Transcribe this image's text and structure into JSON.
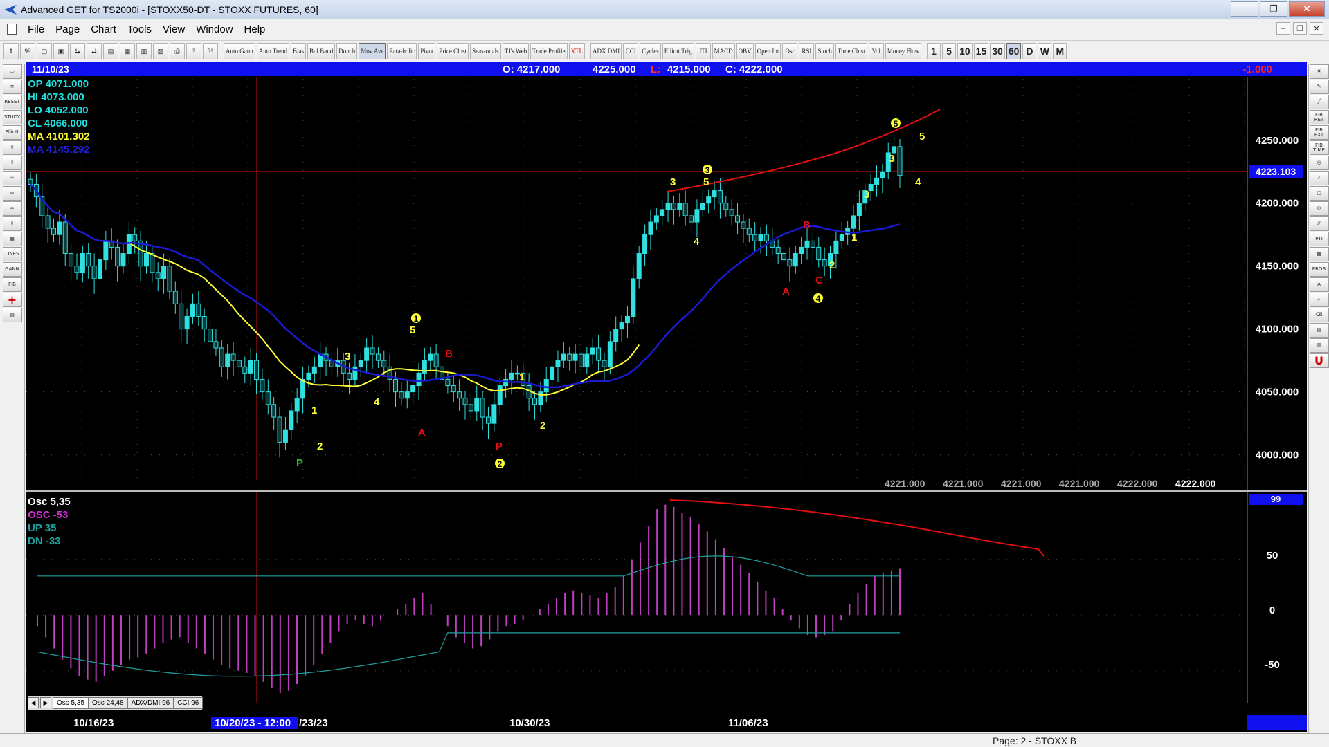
{
  "window": {
    "title": "Advanced GET for TS2000i - [STOXX50-DT - STOXX FUTURES, 60]",
    "minimize": "—",
    "maximize": "❐",
    "close": "✕"
  },
  "menu": {
    "items": [
      "File",
      "Page",
      "Chart",
      "Tools",
      "View",
      "Window",
      "Help"
    ]
  },
  "toolbar": {
    "icons": [
      "⇕",
      "99",
      "▢",
      "▣",
      "⇆",
      "⇄",
      "▤",
      "▦",
      "▥",
      "▨",
      "⎙",
      "?",
      "?!"
    ],
    "studies": [
      "Auto Gann",
      "Auto Trend",
      "Bias",
      "Bol Band",
      "Donch",
      "Mov Ave",
      "Para-bolic",
      "Pivot",
      "Price Clust",
      "Seas-onals",
      "TJ's Web",
      "Trade Profile",
      "XTL",
      "ADX DMI",
      "CCI",
      "Cycles",
      "Elliott Trig",
      "JTI",
      "MACD",
      "OBV",
      "Open Int",
      "Osc",
      "RSI",
      "Stoch",
      "Time Clust",
      "Vol",
      "Money Flow"
    ],
    "timeframes": [
      "1",
      "5",
      "10",
      "15",
      "30",
      "60",
      "D",
      "W",
      "M"
    ],
    "active_timeframe": "60"
  },
  "header": {
    "date": "11/10/23",
    "open": "O: 4217.000",
    "high": "4225.000",
    "low_label": "L:",
    "low": "4215.000",
    "close": "C: 4222.000",
    "change": "-1.000"
  },
  "info_panel": {
    "op": "OP  4071.000",
    "hi": "HI   4073.000",
    "lo": "LO  4052.000",
    "cl": "CL   4066.000",
    "ma1": "MA 4101.302",
    "ma2": "MA 4145.292"
  },
  "price_axis": {
    "labels": [
      "4250.000",
      "4200.000",
      "4150.000",
      "4100.000",
      "4050.000",
      "4000.000"
    ],
    "current_price": "4223.103"
  },
  "bottom_prices": [
    "4221.000",
    "4221.000",
    "4221.000",
    "4221.000",
    "4222.000",
    "4222.000"
  ],
  "osc_panel": {
    "title": "Osc 5,35",
    "osc": "OSC -53",
    "up": "UP   35",
    "dn": "DN   -33",
    "top_value": "99",
    "axis": [
      "50",
      "0",
      "-50"
    ]
  },
  "tabs": [
    "Osc 5,35",
    "Osc 24,48",
    "ADX/DMI 96",
    "CCI 96"
  ],
  "date_axis": {
    "labels": [
      "10/16/23",
      "10/20/23 - 12:00",
      "/23/23",
      "10/30/23",
      "11/06/23"
    ]
  },
  "wave_labels": {
    "yellow": [
      "3",
      "4",
      "1",
      "2",
      "5",
      "1",
      "2",
      "3",
      "4",
      "5",
      "3",
      "4",
      "1",
      "2",
      "3",
      "4",
      "5",
      "5",
      "1"
    ],
    "red": [
      "B",
      "A",
      "A",
      "B",
      "C",
      "P"
    ],
    "green": [
      "P"
    ],
    "circled": [
      "1",
      "2",
      "3",
      "4",
      "5"
    ]
  },
  "status": {
    "page": "Page: 2 - STOXX B"
  },
  "colors": {
    "ma_fast": "#ffff33",
    "ma_slow": "#1a1ad0",
    "candle": "#2ee0e0",
    "channel": "#e01010",
    "osc": "#c040c0",
    "info_cyan": "#22e0e0",
    "info_yellow": "#ffff33",
    "info_blue": "#2222dd",
    "header_bg": "#1010ee"
  },
  "chart_data": {
    "type": "candlestick",
    "price_range": [
      3980,
      4290
    ],
    "osc_range": [
      -75,
      105
    ],
    "closes": [
      4215,
      4205,
      4190,
      4180,
      4175,
      4185,
      4160,
      4150,
      4145,
      4160,
      4150,
      4140,
      4155,
      4170,
      4165,
      4150,
      4160,
      4175,
      4170,
      4150,
      4160,
      4145,
      4140,
      4150,
      4130,
      4120,
      4100,
      4110,
      4120,
      4110,
      4100,
      4090,
      4085,
      4070,
      4080,
      4075,
      4070,
      4065,
      4075,
      4060,
      4050,
      4040,
      4030,
      4010,
      4020,
      4035,
      4045,
      4060,
      4065,
      4070,
      4080,
      4075,
      4070,
      4075,
      4065,
      4060,
      4070,
      4075,
      4085,
      4080,
      4075,
      4070,
      4060,
      4050,
      4045,
      4050,
      4055,
      4065,
      4075,
      4080,
      4070,
      4060,
      4055,
      4050,
      4045,
      4040,
      4035,
      4045,
      4030,
      4025,
      4040,
      4055,
      4060,
      4065,
      4065,
      4055,
      4045,
      4040,
      4050,
      4060,
      4070,
      4075,
      4080,
      4075,
      4080,
      4070,
      4080,
      4085,
      4075,
      4070,
      4090,
      4100,
      4105,
      4110,
      4140,
      4160,
      4175,
      4185,
      4190,
      4195,
      4200,
      4195,
      4200,
      4190,
      4185,
      4195,
      4200,
      4205,
      4210,
      4200,
      4195,
      4190,
      4185,
      4180,
      4175,
      4170,
      4175,
      4170,
      4165,
      4160,
      4155,
      4150,
      4160,
      4165,
      4170,
      4165,
      4155,
      4150,
      4160,
      4170,
      4175,
      4180,
      4190,
      4200,
      4210,
      4215,
      4220,
      4225,
      4240,
      4245,
      4222
    ],
    "osc_values": [
      -10,
      -20,
      -30,
      -40,
      -48,
      -55,
      -58,
      -60,
      -55,
      -50,
      -45,
      -40,
      -38,
      -35,
      -30,
      -25,
      -22,
      -20,
      -25,
      -30,
      -35,
      -40,
      -45,
      -48,
      -50,
      -52,
      -55,
      -60,
      -65,
      -70,
      -68,
      -62,
      -55,
      -45,
      -35,
      -25,
      -15,
      -8,
      -5,
      -8,
      -10,
      -5,
      0,
      5,
      10,
      15,
      20,
      10,
      0,
      -10,
      -20,
      -25,
      -30,
      -28,
      -22,
      -15,
      -10,
      -8,
      -5,
      0,
      5,
      10,
      15,
      20,
      22,
      20,
      18,
      15,
      20,
      25,
      35,
      50,
      65,
      80,
      95,
      99,
      97,
      92,
      88,
      82,
      75,
      68,
      60,
      52,
      45,
      38,
      30,
      22,
      15,
      5,
      -5,
      -12,
      -18,
      -20,
      -18,
      -15,
      -5,
      10,
      20,
      28,
      35,
      38,
      40,
      42
    ]
  }
}
